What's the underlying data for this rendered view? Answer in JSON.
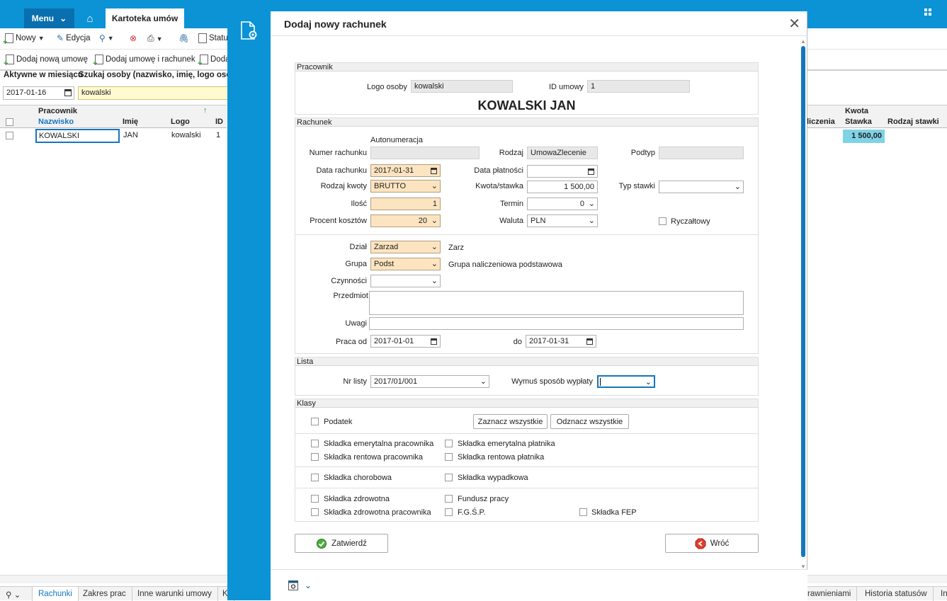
{
  "app": {
    "menu_label": "Menu",
    "active_tab": "Kartoteka umów"
  },
  "toolbar": {
    "new": "Nowy",
    "edit": "Edycja",
    "status": "Statu",
    "add_contract": "Dodaj nową umowę",
    "add_contract_bill": "Dodaj umowę i rachunek",
    "add_more": "Doda"
  },
  "filters": {
    "active_label": "Aktywne w miesiącu",
    "active_value": "2017-01-16",
    "search_label": "Szukaj osoby (nazwisko, imię, logo osoby,",
    "search_value": "kowalski"
  },
  "grid": {
    "group_header": "Pracownik",
    "columns": [
      "Nazwisko",
      "Imię",
      "Logo",
      "ID"
    ],
    "rows": [
      {
        "nazwisko": "KOWALSKI",
        "imie": "JAN",
        "logo": "kowalski",
        "id": "1"
      }
    ],
    "right_group": "Kwota",
    "right_columns": [
      "liczenia",
      "Stawka",
      "Rodzaj stawki"
    ],
    "right_value": "1 500,00"
  },
  "bottom_tabs": [
    "Rachunki",
    "Zakres prac",
    "Inne warunki umowy",
    "K",
    "rawnieniami",
    "Historia statusów",
    "In"
  ],
  "modal": {
    "title": "Dodaj nowy rachunek",
    "pracownik": {
      "section": "Pracownik",
      "logo_label": "Logo osoby",
      "logo_value": "kowalski",
      "id_label": "ID umowy",
      "id_value": "1",
      "full_name": "KOWALSKI JAN"
    },
    "rachunek": {
      "section": "Rachunek",
      "autonum": "Autonumeracja",
      "numer_label": "Numer rachunku",
      "numer_value": "",
      "rodzaj_label": "Rodzaj",
      "rodzaj_value": "UmowaZlecenie",
      "podtyp_label": "Podtyp",
      "podtyp_value": "",
      "data_rach_label": "Data rachunku",
      "data_rach_value": "2017-01-31",
      "data_plat_label": "Data płatności",
      "data_plat_value": "",
      "rodzaj_kwoty_label": "Rodzaj kwoty",
      "rodzaj_kwoty_value": "BRUTTO",
      "kwota_label": "Kwota/stawka",
      "kwota_value": "1 500,00",
      "typ_stawki_label": "Typ stawki",
      "typ_stawki_value": "",
      "ilosc_label": "Ilość",
      "ilosc_value": "1",
      "termin_label": "Termin",
      "termin_value": "0",
      "procent_label": "Procent kosztów",
      "procent_value": "20",
      "waluta_label": "Waluta",
      "waluta_value": "PLN",
      "ryczalt_label": "Ryczałtowy",
      "dzial_label": "Dział",
      "dzial_value": "Zarzad",
      "dzial_desc": "Zarz",
      "grupa_label": "Grupa",
      "grupa_value": "Podst",
      "grupa_desc": "Grupa naliczeniowa podstawowa",
      "czynnosci_label": "Czynności",
      "czynnosci_value": "",
      "przedmiot_label": "Przedmiot",
      "przedmiot_value": "",
      "uwagi_label": "Uwagi",
      "uwagi_value": "",
      "praca_od_label": "Praca od",
      "praca_od_value": "2017-01-01",
      "do_label": "do",
      "do_value": "2017-01-31"
    },
    "lista": {
      "section": "Lista",
      "nr_label": "Nr listy",
      "nr_value": "2017/01/001",
      "wymus_label": "Wymuś sposób wypłaty",
      "wymus_value": ""
    },
    "klasy": {
      "section": "Klasy",
      "podatek": "Podatek",
      "select_all": "Zaznacz wszystkie",
      "deselect_all": "Odznacz wszystkie",
      "items": {
        "emer_prac": "Składka emerytalna pracownika",
        "emer_plat": "Składka emerytalna płatnika",
        "rent_prac": "Składka rentowa pracownika",
        "rent_plat": "Składka rentowa płatnika",
        "chorobowa": "Składka chorobowa",
        "wypadkowa": "Składka wypadkowa",
        "zdrowotna": "Składka zdrowotna",
        "fundusz": "Fundusz pracy",
        "zdrowotna_prac": "Składka zdrowotna pracownika",
        "fgsp": "F.G.Ś.P.",
        "fep": "Składka FEP"
      }
    },
    "confirm": "Zatwierdź",
    "back": "Wróć"
  }
}
